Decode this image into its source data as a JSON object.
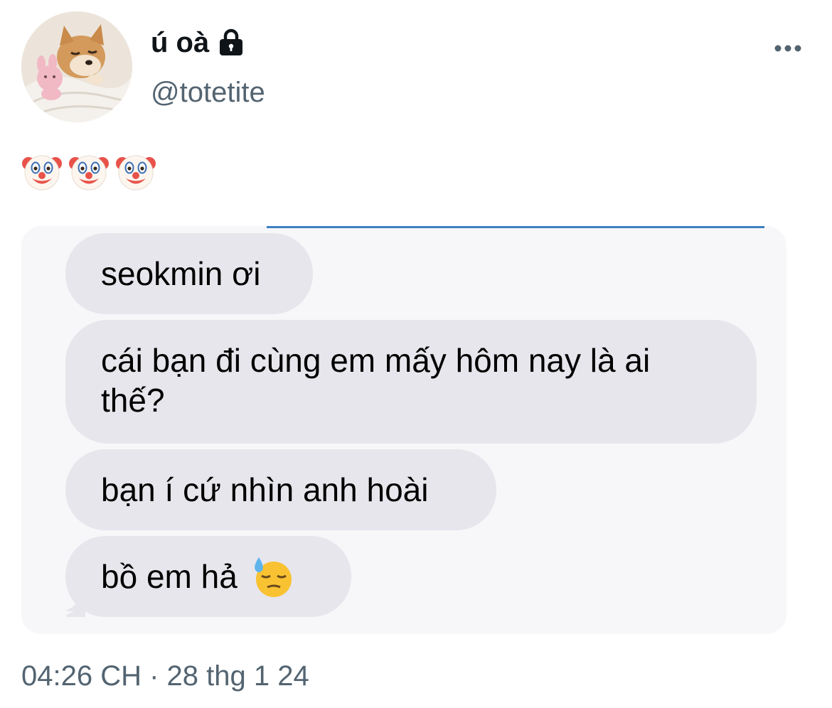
{
  "author": {
    "display_name": "ú oà",
    "username": "@totetite",
    "avatar": "shiba-dog-avatar",
    "lock": "lock-icon"
  },
  "actions": {
    "more": "more-icon"
  },
  "tweet": {
    "text_emojis": [
      "clown-face-emoji",
      "clown-face-emoji",
      "clown-face-emoji"
    ],
    "timestamp": "04:26 CH · 28 thg 1 24"
  },
  "media": {
    "messages": [
      {
        "text": "seokmin ơi"
      },
      {
        "text": "cái bạn đi cùng em mấy hôm nay là ai thế?"
      },
      {
        "text": "bạn í cứ nhìn anh hoài"
      },
      {
        "text": "bồ em hả",
        "emoji": "downcast-face-with-sweat-emoji"
      }
    ]
  },
  "colors": {
    "primary_text": "#0f1419",
    "secondary_text": "#536471",
    "bubble_bg": "#e7e6ec",
    "media_bg": "#f7f7f9"
  }
}
